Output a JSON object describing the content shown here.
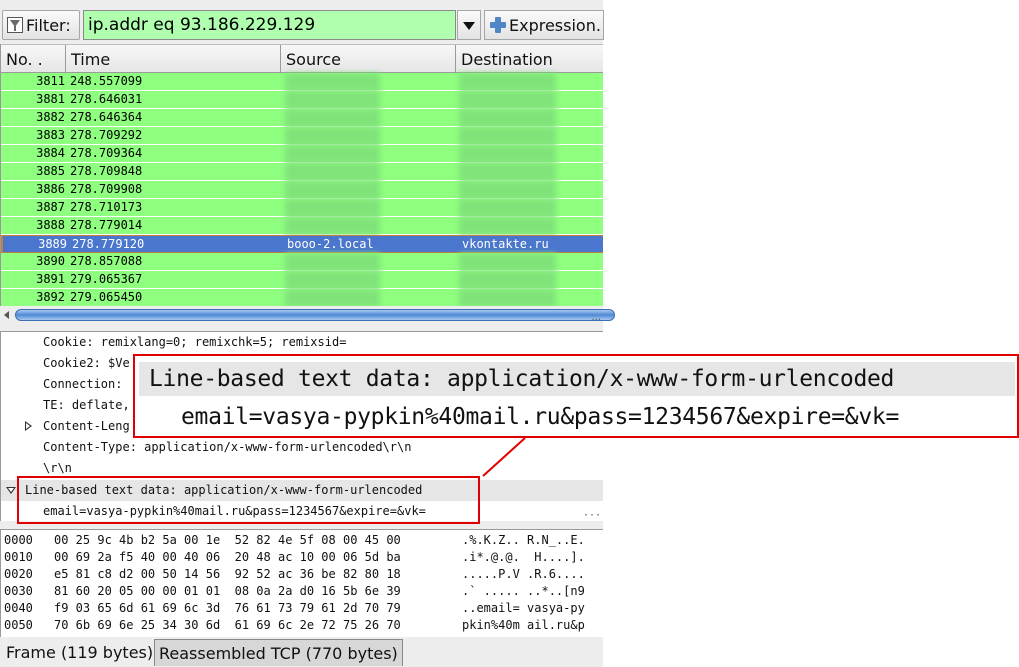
{
  "toolbar": {
    "filter_label": "Filter:",
    "filter_value": "ip.addr eq 93.186.229.129",
    "expression_label": "Expression.",
    "filter_icon": "funnel-icon",
    "expression_icon": "plus-icon",
    "filter_bg_color": "#afffaf"
  },
  "packet_list": {
    "columns": [
      "No. .",
      "Time",
      "Source",
      "Destination"
    ],
    "rows": [
      {
        "no": "3811",
        "time": "248.557099",
        "source": "",
        "destination": ""
      },
      {
        "no": "3881",
        "time": "278.646031",
        "source": "",
        "destination": ""
      },
      {
        "no": "3882",
        "time": "278.646364",
        "source": "",
        "destination": ""
      },
      {
        "no": "3883",
        "time": "278.709292",
        "source": "",
        "destination": ""
      },
      {
        "no": "3884",
        "time": "278.709364",
        "source": "",
        "destination": ""
      },
      {
        "no": "3885",
        "time": "278.709848",
        "source": "",
        "destination": ""
      },
      {
        "no": "3886",
        "time": "278.709908",
        "source": "",
        "destination": ""
      },
      {
        "no": "3887",
        "time": "278.710173",
        "source": "",
        "destination": ""
      },
      {
        "no": "3888",
        "time": "278.779014",
        "source": "",
        "destination": ""
      },
      {
        "no": "3889",
        "time": "278.779120",
        "source": "booo-2.local",
        "destination": "vkontakte.ru",
        "selected": true
      },
      {
        "no": "3890",
        "time": "278.857088",
        "source": "",
        "destination": ""
      },
      {
        "no": "3891",
        "time": "279.065367",
        "source": "",
        "destination": ""
      },
      {
        "no": "3892",
        "time": "279.065450",
        "source": "",
        "destination": ""
      }
    ],
    "row_color": "#8fff7f",
    "selected_color": "#4a76cd"
  },
  "details": {
    "lines": [
      "Cookie: remixlang=0; remixchk=5; remixsid=",
      "Cookie2: $Ve",
      "Connection:",
      "TE: deflate,",
      "Content-Leng",
      "Content-Type: application/x-www-form-urlencoded\\r\\n",
      "\\r\\n",
      "Line-based text data: application/x-www-form-urlencoded",
      "email=vasya-pypkin%40mail.ru&pass=1234567&expire=&vk="
    ]
  },
  "callout": {
    "title": "Line-based text data: application/x-www-form-urlencoded",
    "body": "email=vasya-pypkin%40mail.ru&pass=1234567&expire=&vk=",
    "border_color": "#e00000"
  },
  "hex": {
    "lines": [
      {
        "offset": "0000",
        "bytes": "00 25 9c 4b b2 5a 00 1e  52 82 4e 5f 08 00 45 00",
        "ascii": ".%.K.Z.. R.N_..E."
      },
      {
        "offset": "0010",
        "bytes": "00 69 2a f5 40 00 40 06  20 48 ac 10 00 06 5d ba",
        "ascii": ".i*.@.@.  H....]."
      },
      {
        "offset": "0020",
        "bytes": "e5 81 c8 d2 00 50 14 56  92 52 ac 36 be 82 80 18",
        "ascii": ".....P.V .R.6...."
      },
      {
        "offset": "0030",
        "bytes": "81 60 20 05 00 00 01 01  08 0a 2a d0 16 5b 6e 39",
        "ascii": ".` ..... ..*..[n9"
      },
      {
        "offset": "0040",
        "bytes": "f9 03 65 6d 61 69 6c 3d  76 61 73 79 61 2d 70 79",
        "ascii": "..email= vasya-py"
      },
      {
        "offset": "0050",
        "bytes": "70 6b 69 6e 25 34 30 6d  61 69 6c 2e 72 75 26 70",
        "ascii": "pkin%40m ail.ru&p"
      }
    ]
  },
  "tabs": {
    "frame": "Frame (119 bytes)",
    "reassembled": "Reassembled TCP (770 bytes)"
  }
}
